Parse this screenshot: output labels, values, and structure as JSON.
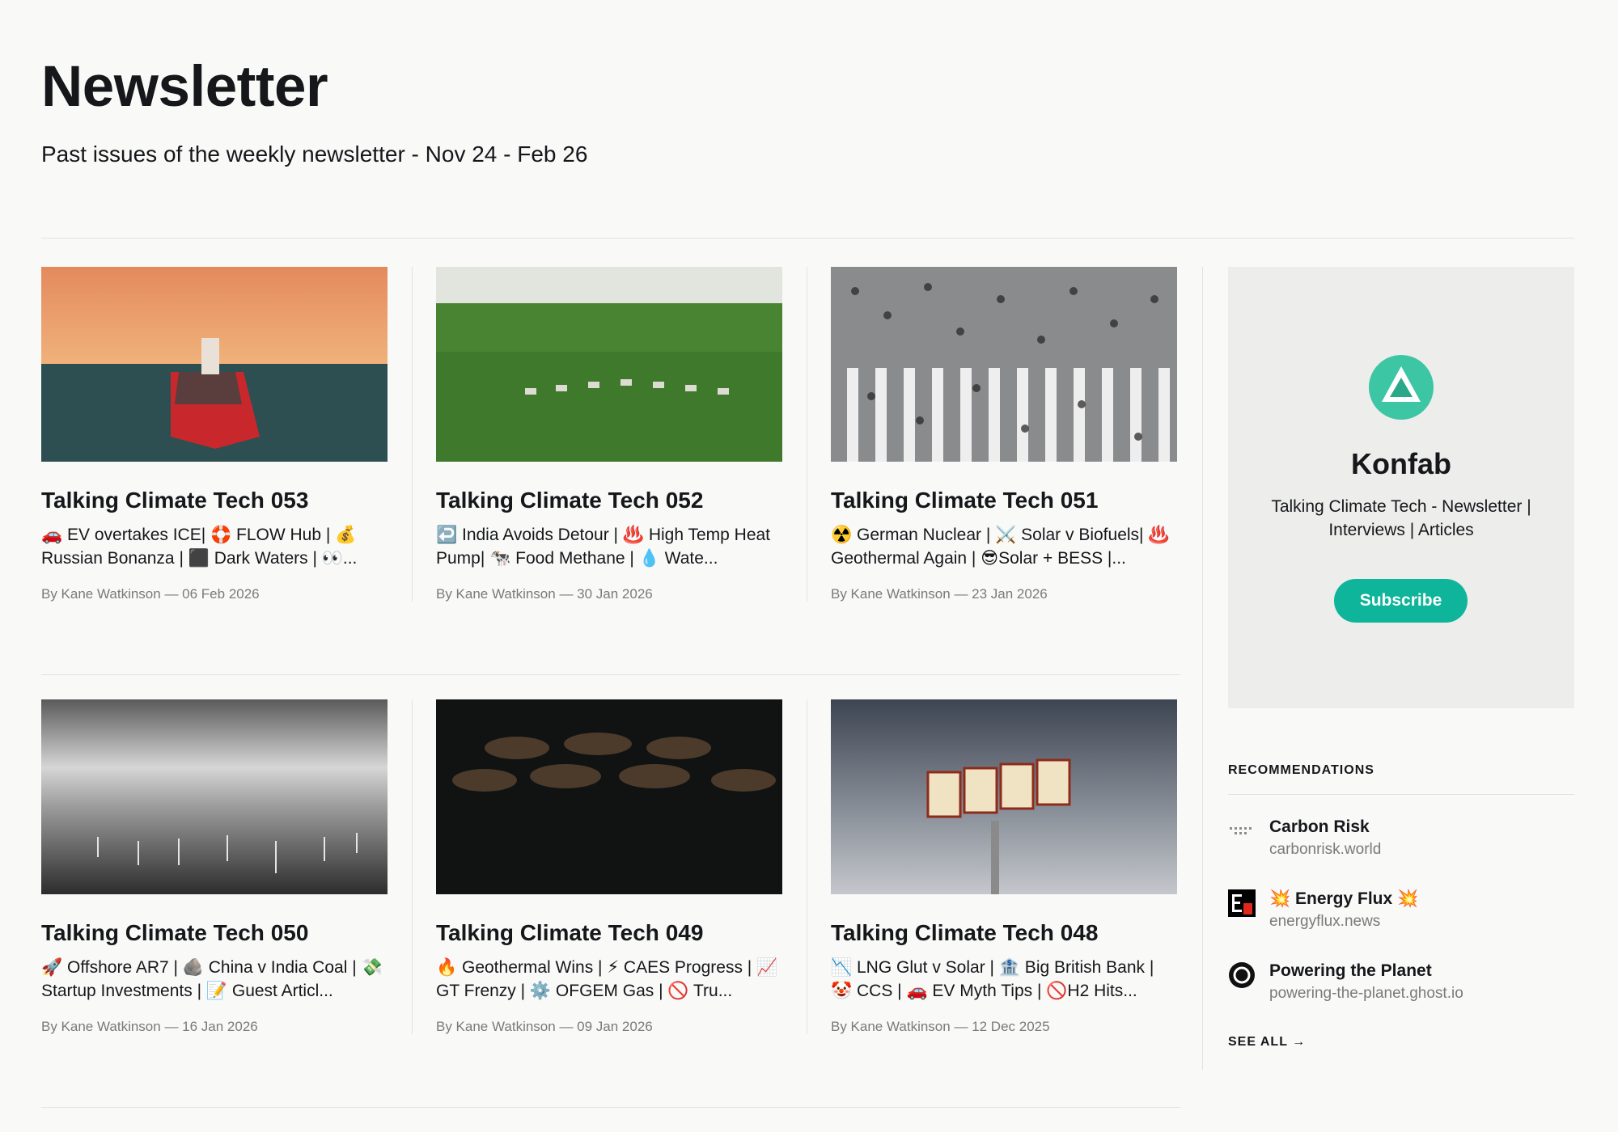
{
  "header": {
    "title": "Newsletter",
    "subtitle": "Past issues of the weekly newsletter - Nov 24 - Feb 26"
  },
  "posts": [
    {
      "title": "Talking Climate Tech 053",
      "excerpt": "🚗 EV overtakes ICE| 🛟 FLOW Hub | 💰 Russian Bonanza | ⬛ Dark Waters | 👀...",
      "meta": "By Kane Watkinson — 06 Feb 2026",
      "image": "oil-tanker-at-sunset"
    },
    {
      "title": "Talking Climate Tech 052",
      "excerpt": "↩️ India Avoids Detour | ♨️ High Temp Heat Pump| 🐄 Food Methane | 💧 Wate...",
      "meta": "By Kane Watkinson — 30 Jan 2026",
      "image": "tractors-in-green-field"
    },
    {
      "title": "Talking Climate Tech 051",
      "excerpt": "☢️ German Nuclear | ⚔️ Solar v Biofuels| ♨️ Geothermal Again | 😎Solar + BESS |...",
      "meta": "By Kane Watkinson — 23 Jan 2026",
      "image": "crowd-on-crosswalk"
    },
    {
      "title": "Talking Climate Tech 050",
      "excerpt": "🚀 Offshore AR7 | 🪨 China v India Coal | 💸 Startup Investments | 📝 Guest Articl...",
      "meta": "By Kane Watkinson — 16 Jan 2026",
      "image": "offshore-wind-farm"
    },
    {
      "title": "Talking Climate Tech 049",
      "excerpt": "🔥 Geothermal Wins | ⚡ CAES Progress | 📈 GT Frenzy | ⚙️ OFGEM Gas | 🚫 Tru...",
      "meta": "By Kane Watkinson — 09 Jan 2026",
      "image": "oil-barrels-dark"
    },
    {
      "title": "Talking Climate Tech 048",
      "excerpt": "📉 LNG Glut v Solar | 🏦 Big British Bank | 🤡 CCS | 🚗 EV Myth Tips | 🚫H2 Hits...",
      "meta": "By Kane Watkinson — 12 Dec 2025",
      "image": "gas-sign-cloudy-sky"
    }
  ],
  "sidebar": {
    "name": "Konfab",
    "description": "Talking Climate Tech - Newsletter | Interviews | Articles",
    "subscribe_label": "Subscribe",
    "recommendations_title": "RECOMMENDATIONS",
    "recommendations": [
      {
        "name": "Carbon Risk",
        "url": "carbonrisk.world",
        "icon": "carbon-risk-icon"
      },
      {
        "name": "💥 Energy Flux 💥",
        "url": "energyflux.news",
        "icon": "energy-flux-icon"
      },
      {
        "name": "Powering the Planet",
        "url": "powering-the-planet.ghost.io",
        "icon": "powering-the-planet-icon"
      }
    ],
    "see_all_label": "SEE ALL →"
  },
  "colors": {
    "accent": "#0eb59a",
    "background": "#f9f9f8",
    "muted": "#7a7a7a"
  }
}
